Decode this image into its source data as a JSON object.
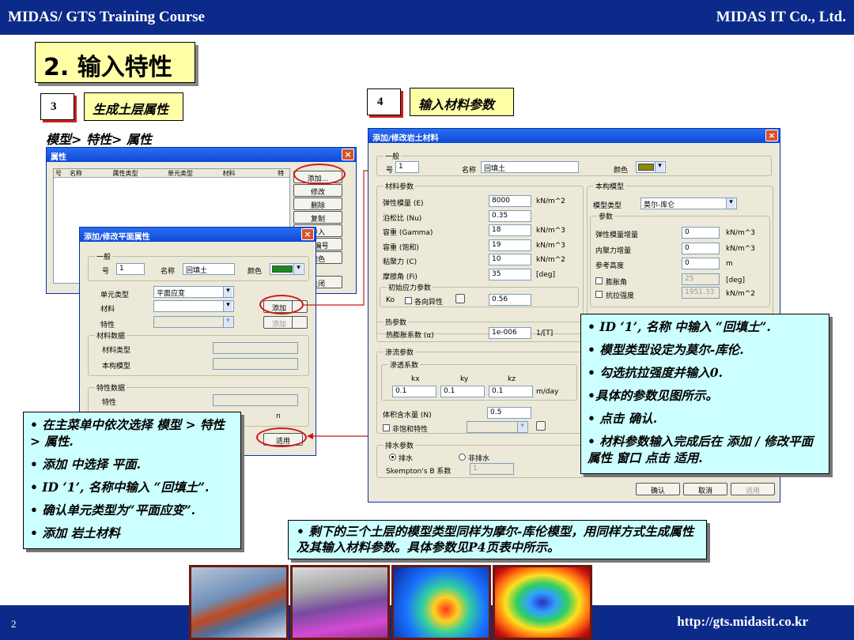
{
  "header": {
    "left": "MIDAS/ GTS Training Course",
    "right": "MIDAS IT Co., Ltd."
  },
  "footer": {
    "page": "2",
    "url": "http://gts.midasit.co.kr"
  },
  "title": "2. 输入特性",
  "step3": {
    "num": "3",
    "label": "生成土层属性"
  },
  "step4": {
    "num": "4",
    "label": "输入材料参数"
  },
  "menu_path": "模型> 特性> 属性",
  "props_window": {
    "title": "属性",
    "columns": [
      "号",
      "名称",
      "属性类型",
      "单元类型",
      "材料",
      "特"
    ],
    "buttons": [
      "添加...",
      "修改",
      "删除",
      "复制",
      "导入",
      "重编号",
      "颜色",
      "关闭"
    ]
  },
  "plane_dialog": {
    "title": "添加/修改平面属性",
    "general": "一般",
    "id_label": "号",
    "id_value": "1",
    "name_label": "名称",
    "name_value": "回填土",
    "color_label": "颜色",
    "color": "#1a8a1a",
    "elem_type_label": "单元类型",
    "elem_type_value": "平面应变",
    "material_label": "材料",
    "property_label": "特性",
    "add_label": "添加",
    "add2_label": "添加",
    "material_data": "材料数据",
    "material_type": "材料类型",
    "constitutive": "本构模型",
    "property_data": "特性数据",
    "property": "特性",
    "n_label": "n",
    "apply": "适用"
  },
  "geo_dialog": {
    "title": "添加/修改岩土材料",
    "general": "一般",
    "id_label": "号",
    "id_value": "1",
    "name_label": "名称",
    "name_value": "回填土",
    "color_label": "颜色",
    "color": "#8a8a10",
    "material_params": "材料参数",
    "params": [
      {
        "label": "弹性模量 (E)",
        "value": "8000",
        "unit": "kN/m^2"
      },
      {
        "label": "泊松比 (Nu)",
        "value": "0.35",
        "unit": ""
      },
      {
        "label": "容重 (Gamma)",
        "value": "18",
        "unit": "kN/m^3"
      },
      {
        "label": "容重 (饱和)",
        "value": "19",
        "unit": "kN/m^3"
      },
      {
        "label": "粘聚力 (C)",
        "value": "10",
        "unit": "kN/m^2"
      },
      {
        "label": "摩擦角 (Fi)",
        "value": "35",
        "unit": "[deg]"
      }
    ],
    "init_stress": "初始应力参数",
    "ko_label": "Ko",
    "aniso_label": "各向异性",
    "ko_value": "0.56",
    "thermal": "热参数",
    "thermal_coef_label": "热膨胀系数 (α)",
    "thermal_coef_value": "1e-006",
    "thermal_unit": "1/[T]",
    "seepage": "渗流参数",
    "permeability": "渗透系数",
    "k_headers": [
      "kx",
      "ky",
      "kz"
    ],
    "k_values": [
      "0.1",
      "0.1",
      "0.1"
    ],
    "k_unit": "m/day",
    "water_content_label": "体积含水量 (N)",
    "water_content_value": "0.5",
    "unsat_label": "非饱和特性",
    "drain": "排水参数",
    "drain_yes": "排水",
    "drain_no": "非排水",
    "skempton_label": "Skempton's B 系数",
    "skempton_value": "1",
    "model_section": "本构模型",
    "model_type_label": "模型类型",
    "model_type_value": "莫尔-库仑",
    "model_params": "参数",
    "model_rows": [
      {
        "label": "弹性模量增量",
        "value": "0",
        "unit": "kN/m^3"
      },
      {
        "label": "内聚力增量",
        "value": "0",
        "unit": "kN/m^3"
      },
      {
        "label": "参考高度",
        "value": "0",
        "unit": "m"
      }
    ],
    "dilation_label": "膨胀角",
    "dilation_value": "25",
    "dilation_unit": "[deg]",
    "tension_label": "抗拉强度",
    "tension_value": "1951.33",
    "tension_unit": "kN/m^2",
    "ok": "确认",
    "cancel": "取消",
    "apply": "适用"
  },
  "note_left": [
    "• 在主菜单中依次选择 模型 > 特性 > 属性.",
    "• 添加 中选择 平面.",
    "• ID ‘1’, 名称中输入 “回填土”.",
    "• 确认单元类型为“平面应变”.",
    "• 添加 岩土材料"
  ],
  "note_right": [
    "• ID ‘1’, 名称 中输入 “回填土”.",
    "• 模型类型设定为莫尔-库伦.",
    "• 勾选抗拉强度并输入0.",
    "•具体的参数见图所示。",
    "• 点击 确认.",
    "• 材料参数输入完成后在 添加 / 修改平面属性 窗口 点击 适用."
  ],
  "note_bottom": "•  剩下的三个土层的模型类型同样为摩尔-库伦模型，用同样方式生成属性及其输入材料参数。具体参数见P4页表中所示。"
}
